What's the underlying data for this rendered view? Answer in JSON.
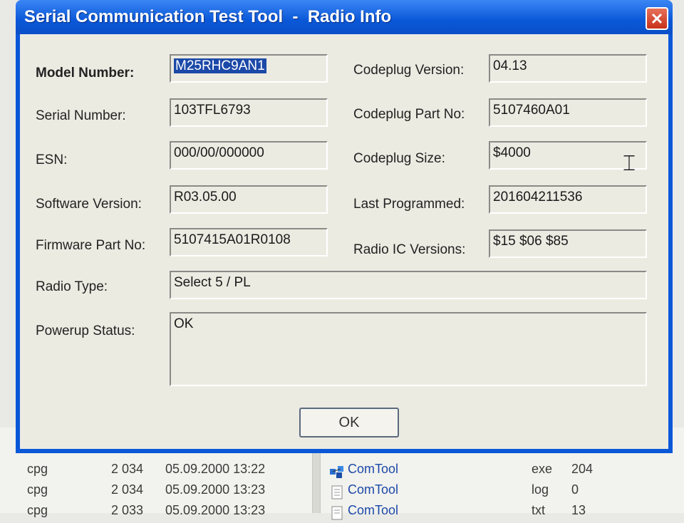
{
  "window": {
    "title": "Serial Communication Test Tool  -  Radio Info"
  },
  "fields": {
    "model_number": {
      "label": "Model Number:",
      "value": "M25RHC9AN1"
    },
    "serial_number": {
      "label": "Serial Number:",
      "value": "103TFL6793"
    },
    "esn": {
      "label": "ESN:",
      "value": "000/00/000000"
    },
    "software_version": {
      "label": "Software Version:",
      "value": "R03.05.00"
    },
    "firmware_part_no": {
      "label": "Firmware Part No:",
      "value": "5107415A01R0108"
    },
    "codeplug_version": {
      "label": "Codeplug Version:",
      "value": "04.13"
    },
    "codeplug_part_no": {
      "label": "Codeplug Part No:",
      "value": "5107460A01"
    },
    "codeplug_size": {
      "label": "Codeplug Size:",
      "value": "$4000"
    },
    "last_programmed": {
      "label": "Last Programmed:",
      "value": "201604211536"
    },
    "radio_ic_versions": {
      "label": "Radio IC Versions:",
      "value": "$15 $06 $85"
    },
    "radio_type": {
      "label": "Radio Type:",
      "value": "Select 5 / PL"
    },
    "powerup_status": {
      "label": "Powerup Status:",
      "value": "OK"
    }
  },
  "buttons": {
    "ok": "OK"
  },
  "background_files": {
    "left": [
      {
        "ext": "cpg",
        "size": "2 034",
        "date": "05.09.2000 13:22"
      },
      {
        "ext": "cpg",
        "size": "2 034",
        "date": "05.09.2000 13:23"
      },
      {
        "ext": "cpg",
        "size": "2 033",
        "date": "05.09.2000 13:23"
      }
    ],
    "right": [
      {
        "name": "ComTool",
        "ext": "exe",
        "size": "204",
        "icon": "app-icon"
      },
      {
        "name": "ComTool",
        "ext": "log",
        "size": "0",
        "icon": "document-icon"
      },
      {
        "name": "ComTool",
        "ext": "txt",
        "size": "13",
        "icon": "document-icon"
      }
    ]
  },
  "colors": {
    "titlebar": "#0a58d8",
    "selection": "#1c49a8",
    "close": "#c8321a"
  }
}
